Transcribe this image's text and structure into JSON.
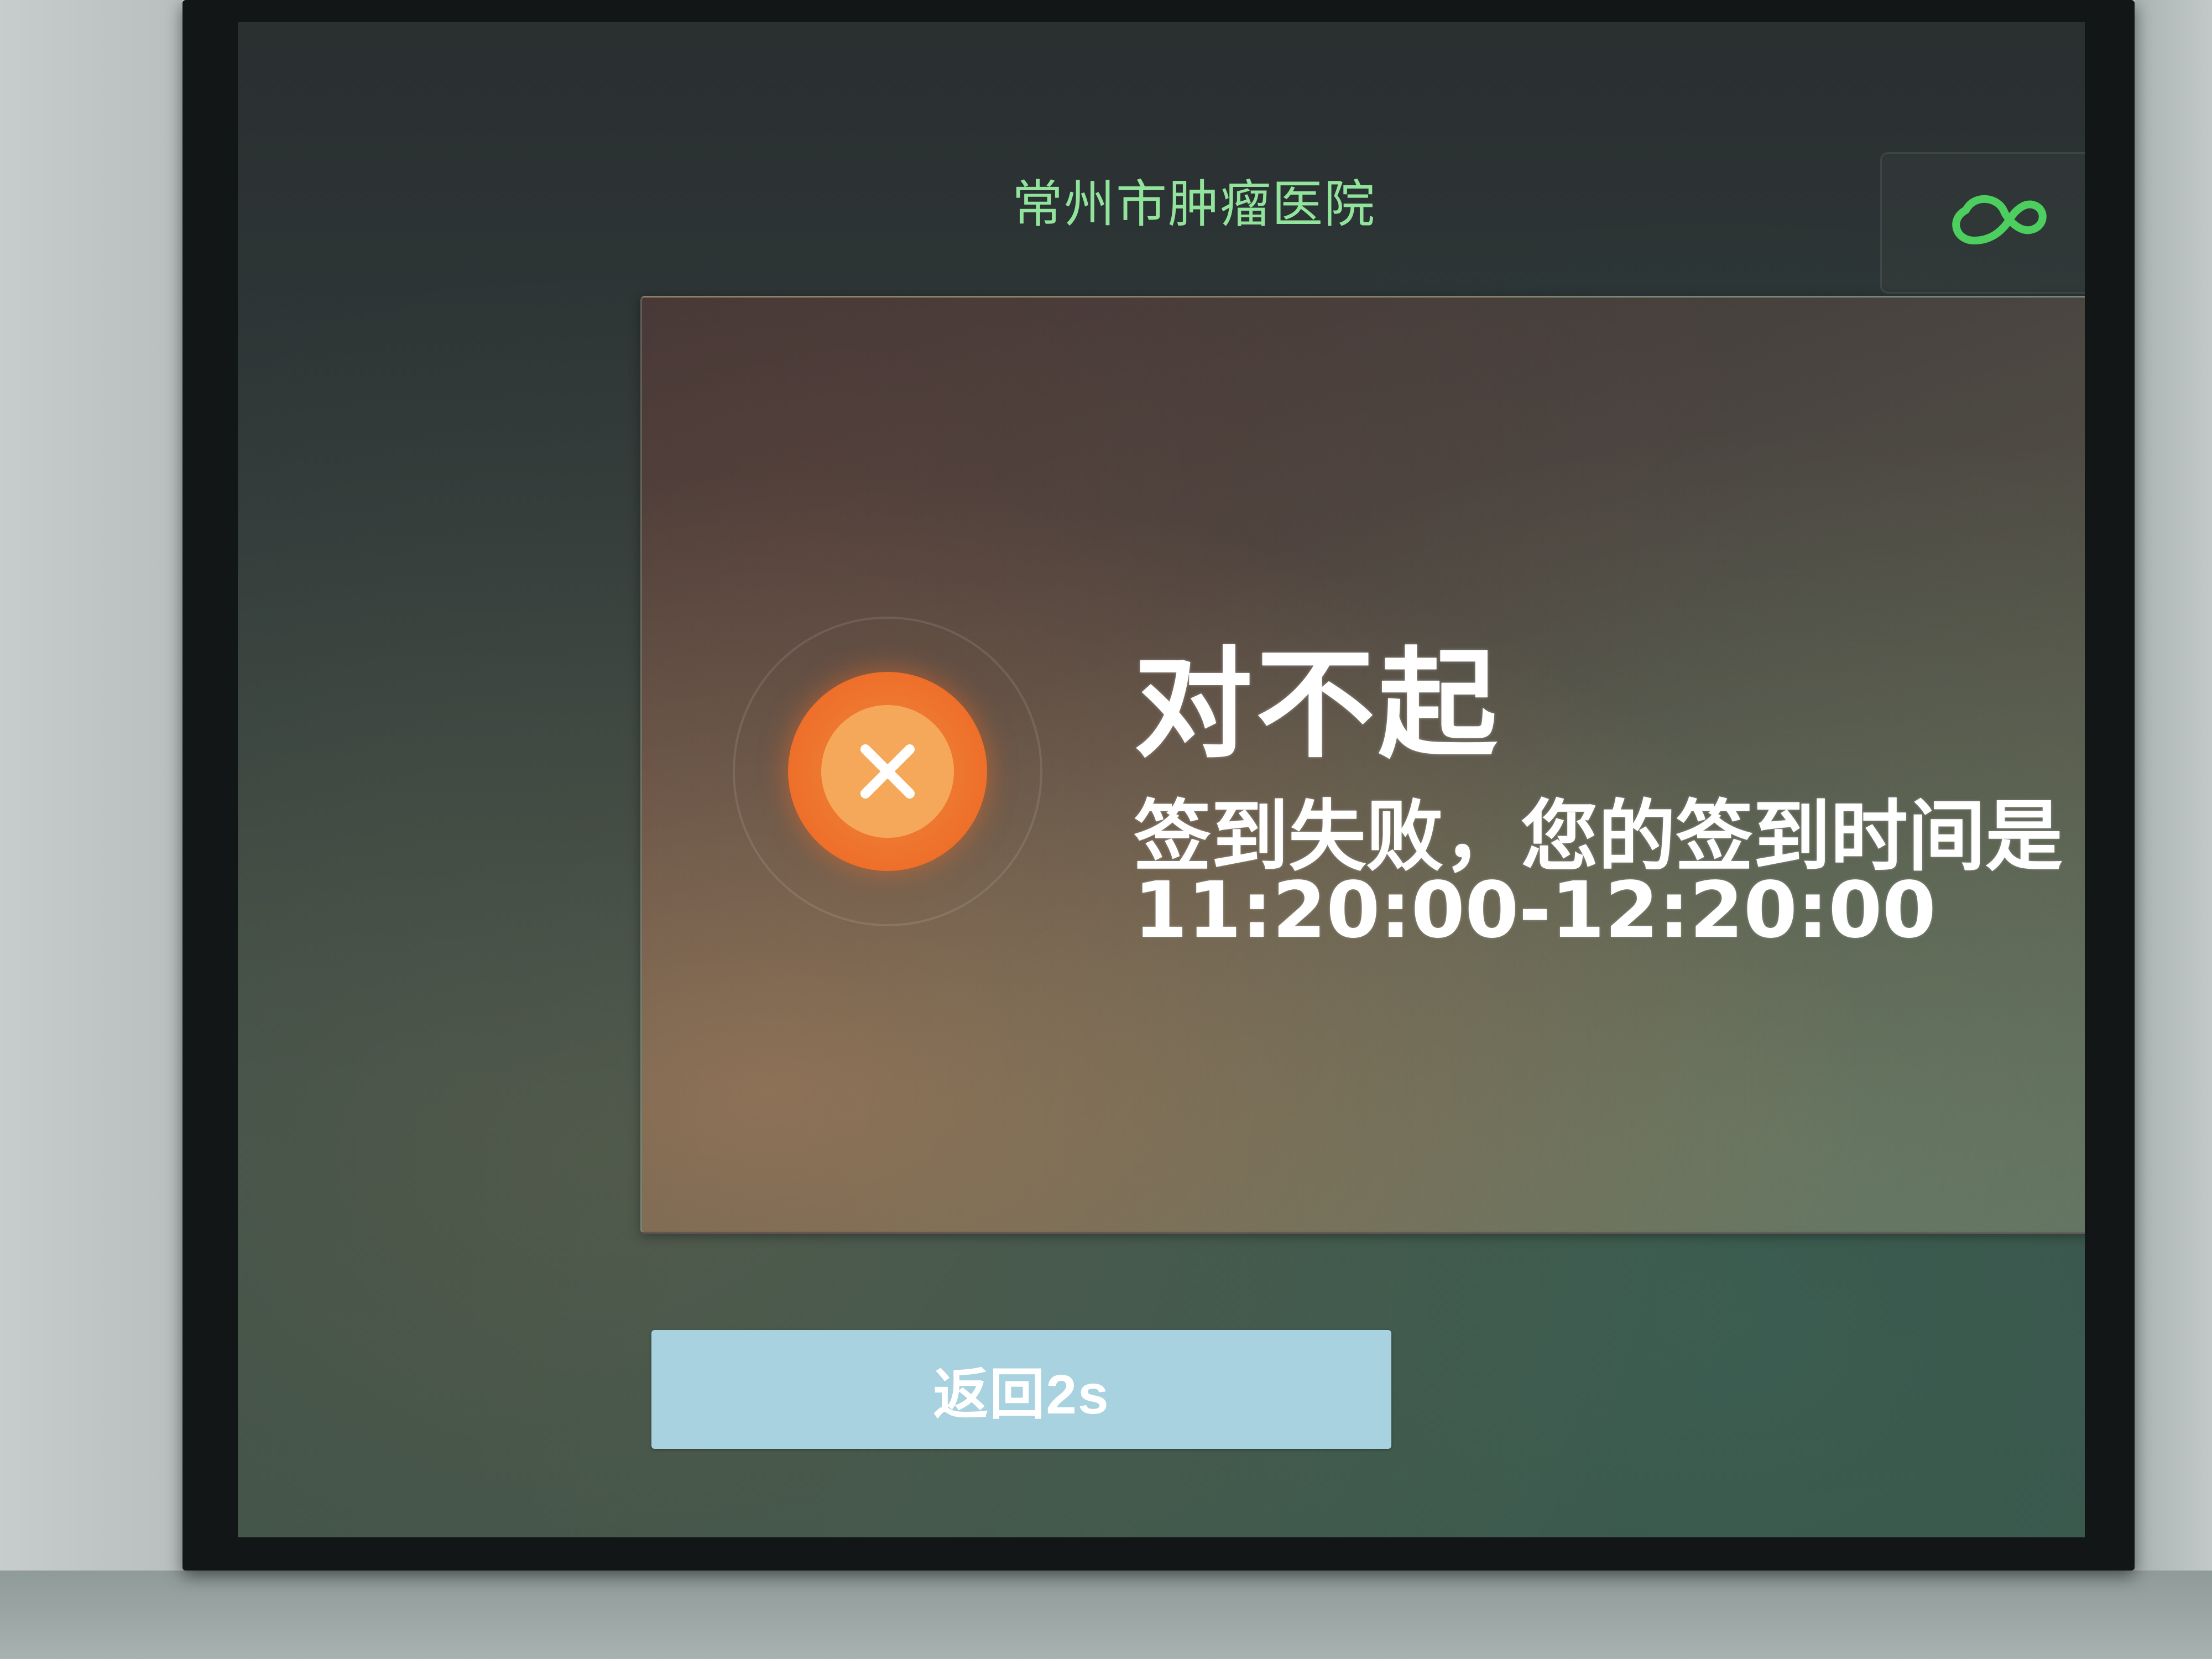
{
  "header": {
    "title": "常州市肿瘤医院",
    "logo_icon": "cloud-link-icon",
    "accent_color": "#92e49d"
  },
  "dialog": {
    "status_icon": "error-x-icon",
    "status_color": "#ee6f2a",
    "title": "对不起",
    "message_line1": "签到失败，您的签到时间是",
    "message_line2": "11:20:00-12:20:00"
  },
  "footer": {
    "back_button_label": "返回2s",
    "back_button_color": "#a8d2e0"
  }
}
